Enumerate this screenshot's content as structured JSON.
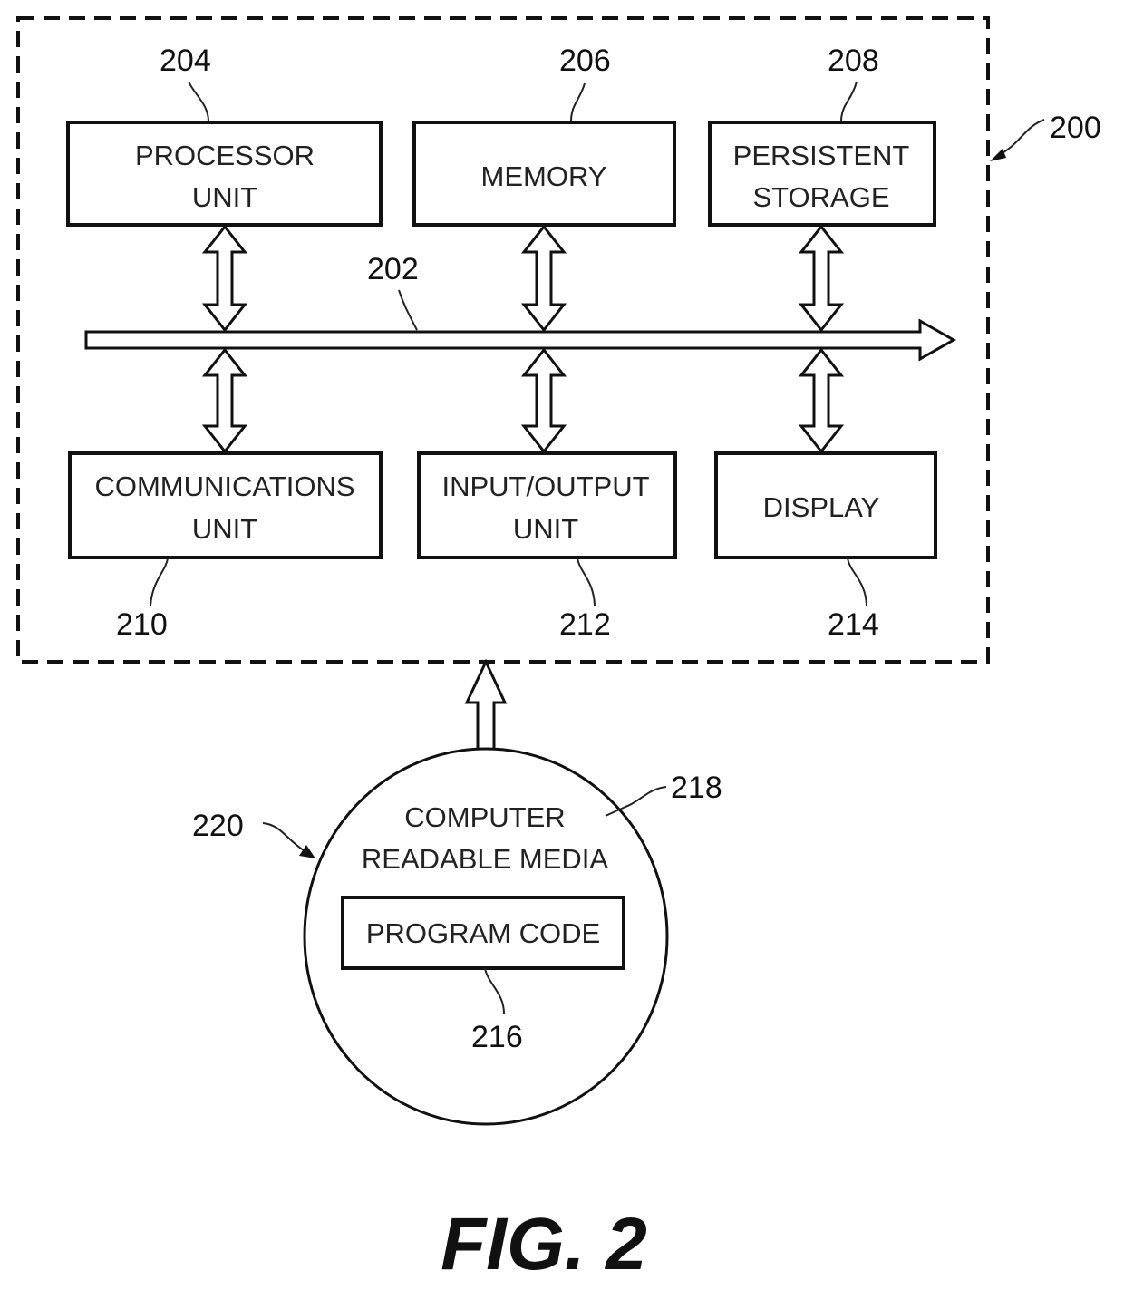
{
  "figure": {
    "title": "FIG. 2",
    "system_ref": "200",
    "bus": {
      "ref": "202"
    },
    "components": [
      {
        "id": "processor",
        "ref": "204",
        "lines": [
          "PROCESSOR",
          "UNIT"
        ]
      },
      {
        "id": "memory",
        "ref": "206",
        "lines": [
          "MEMORY"
        ]
      },
      {
        "id": "persistent-storage",
        "ref": "208",
        "lines": [
          "PERSISTENT",
          "STORAGE"
        ]
      },
      {
        "id": "communications",
        "ref": "210",
        "lines": [
          "COMMUNICATIONS",
          "UNIT"
        ]
      },
      {
        "id": "io",
        "ref": "212",
        "lines": [
          "INPUT/OUTPUT",
          "UNIT"
        ]
      },
      {
        "id": "display",
        "ref": "214",
        "lines": [
          "DISPLAY"
        ]
      }
    ],
    "media": {
      "ref": "220",
      "label_ref": "218",
      "lines": [
        "COMPUTER",
        "READABLE MEDIA"
      ],
      "program_code": {
        "ref": "216",
        "label": "PROGRAM CODE"
      }
    }
  }
}
